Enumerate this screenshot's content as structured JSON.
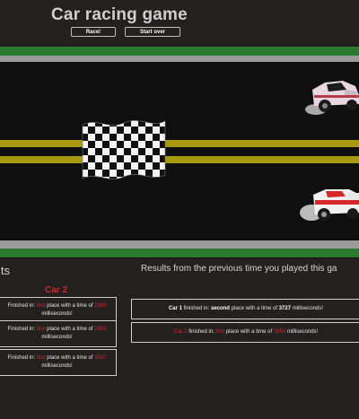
{
  "header": {
    "title": "Car racing game",
    "race_label": "Race!",
    "start_over_label": "Start over"
  },
  "results": {
    "left_heading": "lts",
    "right_heading": "Results from the previous time you played this ga",
    "car_column_title": "Car 2",
    "left_rows": [
      {
        "prefix": "Finished in:",
        "place": "first",
        "mid": "place with a time of",
        "time": "2380",
        "suffix": "milliseconds!"
      },
      {
        "prefix": "Finished in:",
        "place": "first",
        "mid": "place with a time of",
        "time": "2853",
        "suffix": "milliseconds!"
      },
      {
        "prefix": "Finished in:",
        "place": "first",
        "mid": "place with a time of",
        "time": "3037",
        "suffix": "milliseconds!"
      }
    ],
    "right_rows": [
      {
        "car": "Car 1",
        "prefix": "finished in:",
        "place": "second",
        "mid": "place with a time of",
        "time": "3727",
        "suffix": "milliseconds!"
      },
      {
        "car": "Car 2",
        "prefix": "finished in:",
        "place": "first",
        "mid": "place with a time of",
        "time": "2853",
        "suffix": "milliseconds!"
      }
    ]
  },
  "colors": {
    "background": "#232020",
    "grass": "#2a7a2e",
    "curb": "#9b9b9b",
    "lane": "#a89a10",
    "highlight_red": "#d8262a"
  },
  "icons": {
    "flag": "checkered-flag-icon",
    "car": "race-car-icon"
  }
}
